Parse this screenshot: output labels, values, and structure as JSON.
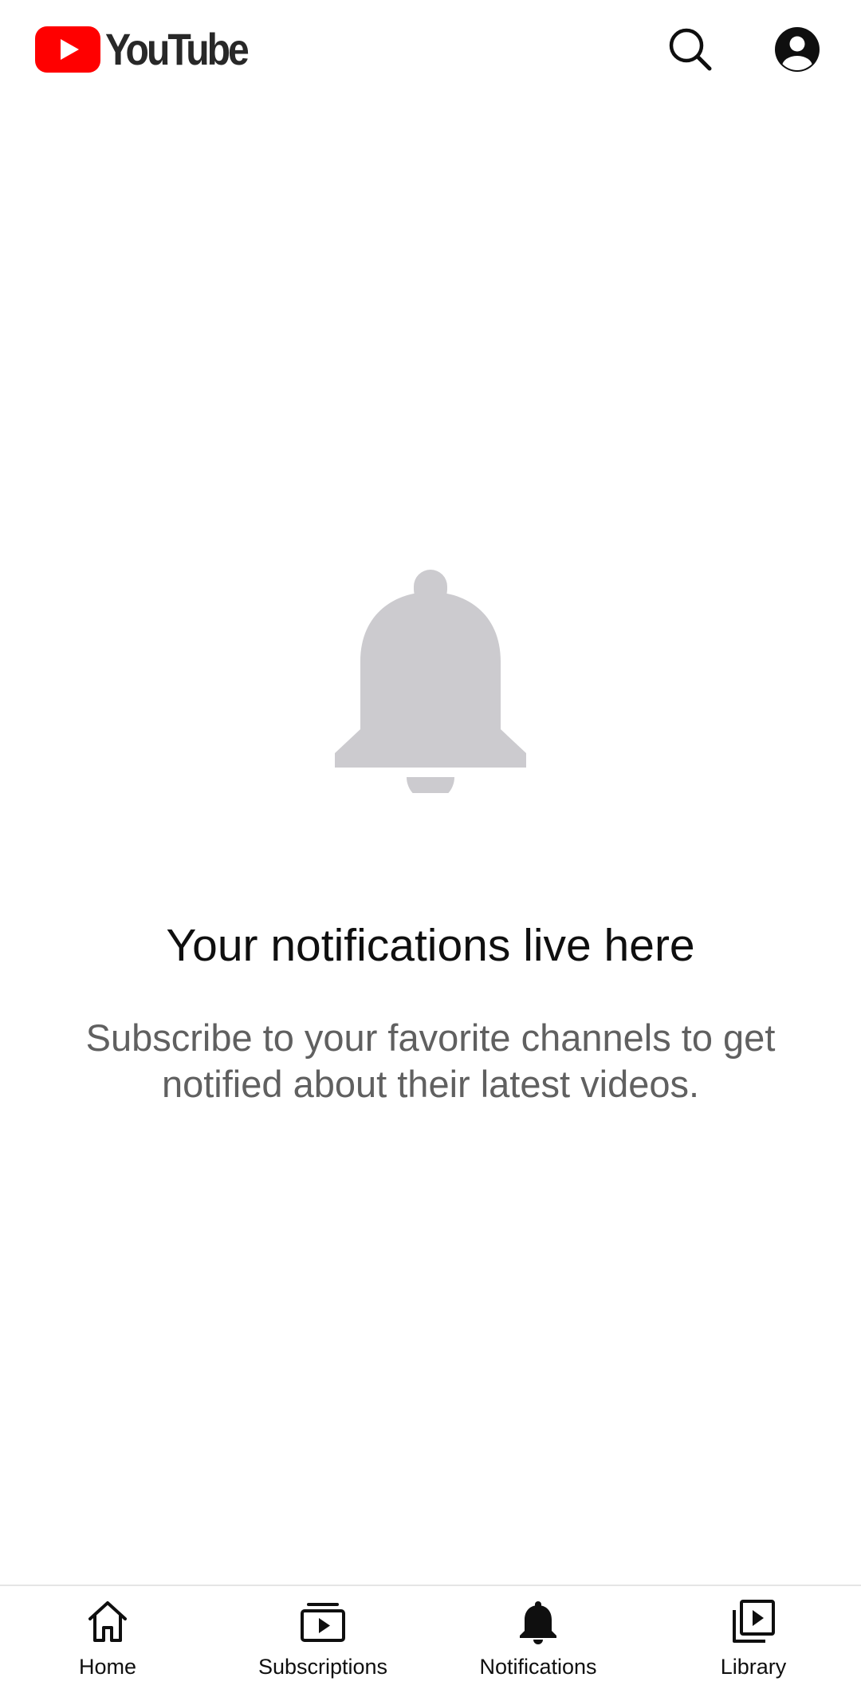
{
  "app": {
    "logo_text": "YouTube",
    "brand_color": "#ff0000"
  },
  "header": {
    "search_icon": "search-icon",
    "account_icon": "account-circle-icon"
  },
  "empty_state": {
    "icon": "bell-icon",
    "title": "Your notifications live here",
    "message": "Subscribe to your favorite channels to get notified about their latest videos."
  },
  "bottom_nav": {
    "items": [
      {
        "label": "Home",
        "icon": "home-icon",
        "selected": false
      },
      {
        "label": "Subscriptions",
        "icon": "subscriptions-icon",
        "selected": false
      },
      {
        "label": "Notifications",
        "icon": "bell-icon",
        "selected": true
      },
      {
        "label": "Library",
        "icon": "library-icon",
        "selected": false
      }
    ]
  },
  "colors": {
    "text_primary": "#0f0f0f",
    "text_secondary": "#606060",
    "icon_muted": "#cccbcf",
    "divider": "#e5e5e5"
  }
}
